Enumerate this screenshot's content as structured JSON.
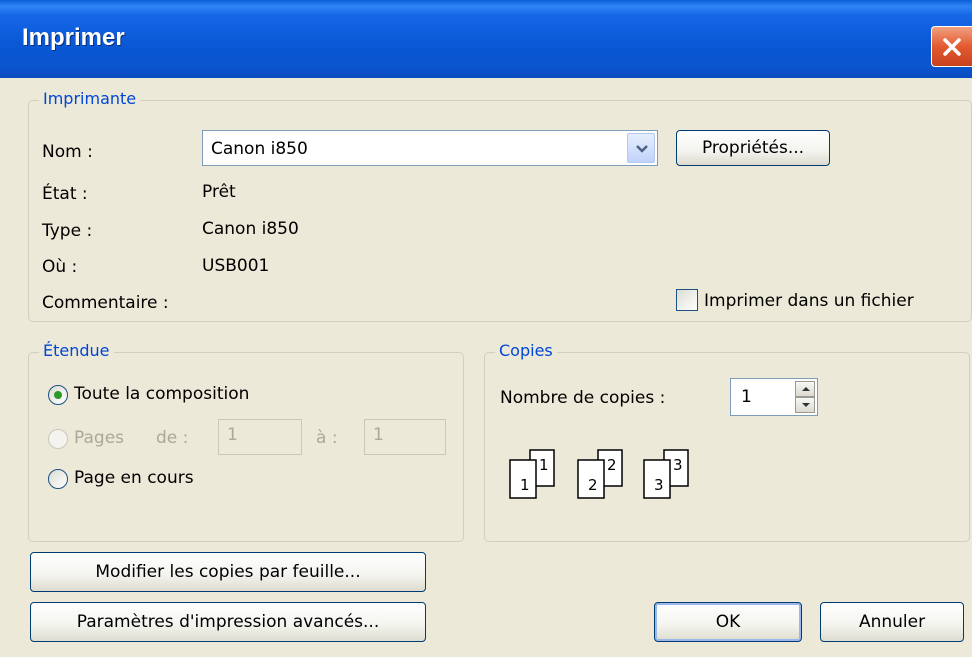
{
  "window": {
    "title": "Imprimer"
  },
  "printer_group": {
    "legend": "Imprimante",
    "name_label": "Nom :",
    "name_value": "Canon i850",
    "properties_button": "Propriétés...",
    "status_label": "État :",
    "status_value": "Prêt",
    "type_label": "Type :",
    "type_value": "Canon i850",
    "where_label": "Où :",
    "where_value": "USB001",
    "comment_label": "Commentaire :",
    "print_to_file_label": "Imprimer dans un fichier",
    "print_to_file_checked": false
  },
  "range_group": {
    "legend": "Étendue",
    "all_label": "Toute la composition",
    "pages_label": "Pages",
    "from_label": "de :",
    "from_value": "1",
    "to_label": "à :",
    "to_value": "1",
    "current_label": "Page en cours",
    "selected": "all"
  },
  "copies_group": {
    "legend": "Copies",
    "count_label": "Nombre de copies :",
    "count_value": "1",
    "collate_icons": [
      "1",
      "2",
      "3"
    ]
  },
  "buttons": {
    "modify_copies": "Modifier les copies par feuille...",
    "advanced": "Paramètres d'impression avancés...",
    "ok": "OK",
    "cancel": "Annuler"
  }
}
